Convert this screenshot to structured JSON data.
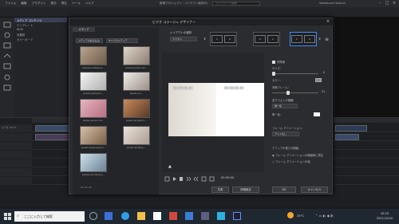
{
  "app": {
    "menu": [
      "ファイル",
      "編集",
      "プラグイン",
      "表示",
      "再生",
      "ツール",
      "ヘルプ"
    ],
    "title": "新規プロジェクト・(ドラフト保存中)",
    "search_placeholder": "ライブラリーの検索",
    "user": "Yoshitsune Hirauchi",
    "left_items": [
      "メディア コンテンツ",
      "テンプレート",
      "BGM",
      "効果音",
      "カラーボード"
    ],
    "timeline_head": "ビデオ 20-YC"
  },
  "dialog": {
    "title": "ビデオ コラージュ デザイナー",
    "media_tab": "メディア",
    "import_label": "メディアの読み込み",
    "filter_label": "すべてのメディア",
    "thumbnails": [
      {
        "label": "pexels-jonathan-b..."
      },
      {
        "label": "pexels-jeremy-wo..."
      },
      {
        "label": "pexels-joshua-m..."
      },
      {
        "label": "pexels-ra-..."
      },
      {
        "label": "pexels-pavel-cnh..."
      },
      {
        "label": "pexels-jacquelin-..."
      },
      {
        "label": "pexels-sleeping-dan..."
      },
      {
        "label": "pexels-pixabay-..."
      },
      {
        "label": "pexels-vanderlei-s..."
      }
    ],
    "layout_label": "レイアウトの選択",
    "layout_dropdown": "カスタム",
    "layouts": [
      {
        "cells": [
          "1",
          "2"
        ]
      },
      {
        "cells": [
          "2",
          "1"
        ]
      },
      {
        "cells": [
          "1",
          "2"
        ]
      }
    ],
    "timecode_left": "00:00:00.00",
    "timecode_right": "00:00:00.00",
    "playback_time": "00:00:00",
    "settings": {
      "border_title": "境界線",
      "size_label": "サイズ:",
      "size_value": "0",
      "color_label": "カラー:",
      "inner_label": "内側フレーム:",
      "inner_value": "23",
      "fill_label": "塗りつぶしの種類:",
      "fill_value": "単一色",
      "single_color": "単一色:",
      "anim_label": "フレーム アニメーション:",
      "anim_value": "アニメなし",
      "clip_label": "クリップの長さの開始:",
      "radio1": "フレーム アニメーションの開始時に再生",
      "radio2": "フレーム アニメーションの後"
    },
    "buttons": {
      "share": "共有",
      "advanced": "詳細設定",
      "ok": "OK",
      "cancel": "キャンセル"
    }
  },
  "taskbar": {
    "search_placeholder": "ここに入力して検索",
    "temp": "25°C",
    "time": "10:23",
    "date": "2021/10/20"
  },
  "colors": {
    "accent": "#3f8cff",
    "dialog_bg": "#2b2c30",
    "taskbar": "#1f2730"
  }
}
